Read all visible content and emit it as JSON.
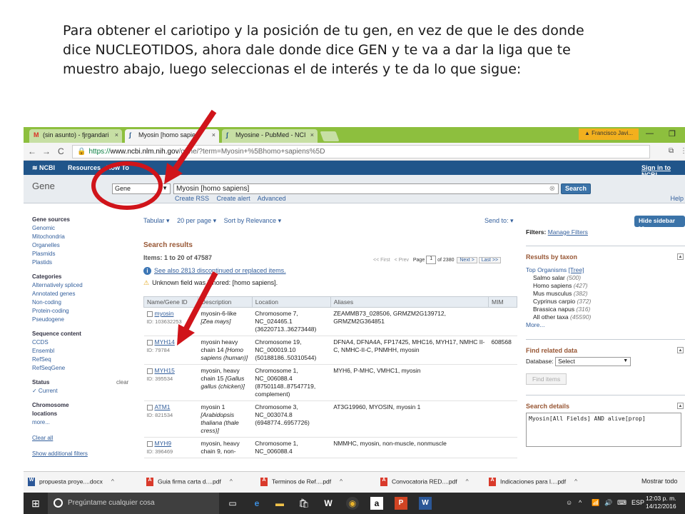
{
  "caption": {
    "line1": "Para obtener el cariotipo y la posición de tu gen, en vez de que le des donde",
    "line2": "dice NUCLEOTIDOS, ahora dale donde dice GEN y te va a dar la liga que te",
    "line3": "muestro abajo, luego seleccionas el de interés y te da lo que sigue:"
  },
  "browser": {
    "tabs": [
      {
        "icon": "M",
        "label": "(sin asunto) - fjrgandari",
        "close": "×"
      },
      {
        "icon": "∫",
        "label": "Myosin [homo sapien",
        "close": "×"
      },
      {
        "icon": "∫",
        "label": "Myosine - PubMed - NCI",
        "close": "×"
      }
    ],
    "user": "▲ Francisco Javi...",
    "window_controls": {
      "minimize": "—",
      "restore": "❐"
    },
    "url": {
      "scheme": "https://",
      "host": "www.ncbi.nlm.nih.gov",
      "path": "/gene/?term=Myosin+%5Bhomo+sapiens%5D"
    },
    "nav": {
      "back": "←",
      "forward": "→",
      "reload": "C"
    }
  },
  "ncbi": {
    "logo": "NCBI",
    "resources": "Resources",
    "howto": "How To",
    "signin": "Sign in to NCBI"
  },
  "search": {
    "title": "Gene",
    "db": "Gene",
    "term": "Myosin [homo sapiens]",
    "button": "Search",
    "create_rss": "Create RSS",
    "create_alert": "Create alert",
    "advanced": "Advanced",
    "help": "Help"
  },
  "leftnav": {
    "gene_sources": "Gene sources",
    "sources": [
      "Genomic",
      "Mitochondria",
      "Organelles",
      "Plasmids",
      "Plastids"
    ],
    "categories": "Categories",
    "category_items": [
      "Alternatively spliced",
      "Annotated genes",
      "Non-coding",
      "Protein-coding",
      "Pseudogene"
    ],
    "seq_content": "Sequence content",
    "seq_items": [
      "CCDS",
      "Ensembl",
      "RefSeq",
      "RefSeqGene"
    ],
    "status": "Status",
    "clear": "clear",
    "current": "✓ Current",
    "chrom": "Chromosome",
    "locations": "locations",
    "more": "more...",
    "clear_all": "Clear all",
    "show_filters": "Show additional filters"
  },
  "results": {
    "format": "Tabular ▾",
    "per_page": "20 per page ▾",
    "sort": "Sort by Relevance ▾",
    "send_to": "Send to: ▾",
    "title": "Search results",
    "items": "Items: 1 to 20 of 47587",
    "pager": {
      "first": "<< First",
      "prev": "< Prev",
      "page_label": "Page",
      "page": "1",
      "of": "of 2380",
      "next": "Next >",
      "last": "Last >>"
    },
    "see_also": "See also 2813 discontinued or replaced items.",
    "unknown_field": "Unknown field was ignored: [homo sapiens].",
    "columns": [
      "Name/Gene ID",
      "Description",
      "Location",
      "Aliases",
      "MIM"
    ],
    "rows": [
      {
        "name": "myosin",
        "id": "ID: 103632253",
        "desc": "myosin-6-like",
        "org": "[Zea mays]",
        "loc1": "Chromosome 7,",
        "loc2": "NC_024465.1",
        "loc3": "(36220713..36273448)",
        "aliases": "ZEAMMB73_028506, GRMZM2G139712, GRMZM2G364851",
        "mim": ""
      },
      {
        "name": "MYH14",
        "id": "ID: 79784",
        "desc": "myosin heavy chain 14",
        "org": "[Homo sapiens (human)]",
        "loc1": "Chromosome 19,",
        "loc2": "NC_000019.10",
        "loc3": "(50188186..50310544)",
        "aliases": "DFNA4, DFNA4A, FP17425, MHC16, MYH17, NMHC II-C, NMHC-II-C, PNMHH, myosin",
        "mim": "608568"
      },
      {
        "name": "MYH15",
        "id": "ID: 395534",
        "desc": "myosin, heavy chain 15",
        "org": "[Gallus gallus (chicken)]",
        "loc1": "Chromosome 1,",
        "loc2": "NC_006088.4",
        "loc3": "(87501148..87547719, complement)",
        "aliases": "MYH6, P-MHC, VMHC1, myosin",
        "mim": ""
      },
      {
        "name": "ATM1",
        "id": "ID: 821534",
        "desc": "myosin 1",
        "org": "[Arabidopsis thaliana (thale cress)]",
        "loc1": "Chromosome 3,",
        "loc2": "NC_003074.8",
        "loc3": "(6948774..6957726)",
        "aliases": "AT3G19960, MYOSIN, myosin 1",
        "mim": ""
      },
      {
        "name": "MYH9",
        "id": "ID: 396469",
        "desc": "myosin, heavy chain 9, non-",
        "org": "",
        "loc1": "Chromosome 1,",
        "loc2": "NC_006088.4",
        "loc3": "",
        "aliases": "NMMHC, myosin, non-muscle, nonmuscle",
        "mim": ""
      }
    ]
  },
  "rside": {
    "hide": "Hide sidebar >>",
    "filters_label": "Filters:",
    "manage": "Manage Filters",
    "taxon_title": "Results by taxon",
    "top_orgs": "Top Organisms",
    "tree": "[Tree]",
    "taxa": [
      {
        "name": "Salmo salar",
        "count": "(500)"
      },
      {
        "name": "Homo sapiens",
        "count": "(427)"
      },
      {
        "name": "Mus musculus",
        "count": "(382)"
      },
      {
        "name": "Cyprinus carpio",
        "count": "(372)"
      },
      {
        "name": "Brassica napus",
        "count": "(316)"
      },
      {
        "name": "All other taxa",
        "count": "(45590)"
      }
    ],
    "more": "More...",
    "related_title": "Find related data",
    "database_label": "Database:",
    "database_value": "Select",
    "find_items": "Find items",
    "details_title": "Search details",
    "details_query": "Myosin[All Fields] AND alive[prop]"
  },
  "downloads": {
    "items": [
      {
        "type": "word",
        "name": "propuesta proye....docx"
      },
      {
        "type": "pdf",
        "name": "Guia firma carta d....pdf"
      },
      {
        "type": "pdf",
        "name": "Terminos de      Ref....pdf"
      },
      {
        "type": "pdf",
        "name": "Convocatoria RED....pdf"
      },
      {
        "type": "pdf",
        "name": "Indicaciones para l....pdf"
      }
    ],
    "show_all": "Mostrar todo",
    "close": "×"
  },
  "taskbar": {
    "search_placeholder": "Pregúntame cualquier cosa",
    "lang": "ESP",
    "time": "12:03 p. m.",
    "date": "14/12/2016"
  },
  "colors": {
    "chrome_tabbar": "#8dbf3e",
    "ncbi_blue": "#20558a",
    "link": "#335f9c",
    "heading_brown": "#985735",
    "annotation_red": "#d0141a"
  }
}
